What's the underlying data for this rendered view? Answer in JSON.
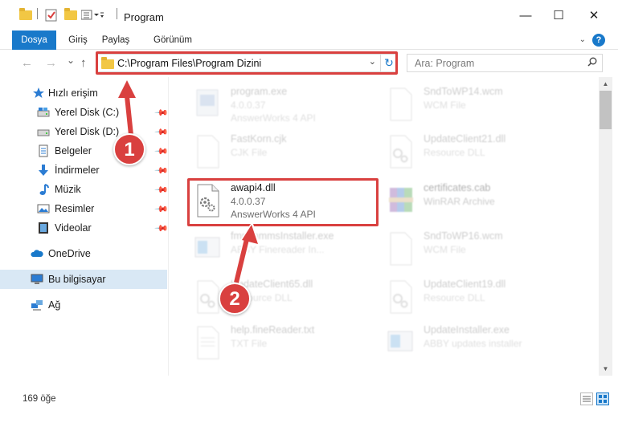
{
  "window": {
    "title": "Program",
    "minimize": "—",
    "maximize": "☐",
    "close": "✕"
  },
  "ribbon": {
    "tabs": [
      "Dosya",
      "Giriş",
      "Paylaş",
      "Görünüm"
    ],
    "help": "?"
  },
  "navigation": {
    "back": "←",
    "forward": "→",
    "recent": "⌄",
    "up": "↑",
    "address": "C:\\Program Files\\Program Dizini",
    "refresh": "↻",
    "search_placeholder": "Ara: Program"
  },
  "sidebar": {
    "quick_access": "Hızlı erişim",
    "items": [
      {
        "label": "Yerel Disk (C:)",
        "icon": "drive-icon",
        "pinned": true
      },
      {
        "label": "Yerel Disk (D:)",
        "icon": "drive-icon",
        "pinned": true
      },
      {
        "label": "Belgeler",
        "icon": "documents-icon",
        "pinned": true
      },
      {
        "label": "İndirmeler",
        "icon": "downloads-icon",
        "pinned": true
      },
      {
        "label": "Müzik",
        "icon": "music-icon",
        "pinned": true
      },
      {
        "label": "Resimler",
        "icon": "pictures-icon",
        "pinned": true
      },
      {
        "label": "Videolar",
        "icon": "videos-icon",
        "pinned": true
      }
    ],
    "onedrive": "OneDrive",
    "this_pc": "Bu bilgisayar",
    "network": "Ağ",
    "pin_glyph": "📌"
  },
  "files": [
    {
      "name": "program.exe",
      "l2": "4.0.0.37",
      "l3": "AnswerWorks 4 API",
      "icon": "exe-icon"
    },
    {
      "name": "SndToWP14.wcm",
      "l2": "WCM File",
      "l3": "",
      "icon": "blank-file-icon"
    },
    {
      "name": "FastKorn.cjk",
      "l2": "CJK File",
      "l3": "",
      "icon": "blank-file-icon"
    },
    {
      "name": "UpdateClient21.dll",
      "l2": "Resource DLL",
      "l3": "",
      "icon": "dll-icon"
    },
    {
      "name": "awapi4.dll",
      "l2": "4.0.0.37",
      "l3": "AnswerWorks 4 API",
      "icon": "dll-icon"
    },
    {
      "name": "certificates.cab",
      "l2": "WinRAR Archive",
      "l3": "",
      "icon": "archive-icon"
    },
    {
      "name": "fmmmmmsInstaller.exe",
      "l2": "ABBY Finereader In...",
      "l3": "",
      "icon": "installer-icon"
    },
    {
      "name": "SndToWP16.wcm",
      "l2": "WCM File",
      "l3": "",
      "icon": "blank-file-icon"
    },
    {
      "name": "UpdateClient65.dll",
      "l2": "Resource DLL",
      "l3": "",
      "icon": "dll-icon"
    },
    {
      "name": "UpdateClient19.dll",
      "l2": "Resource DLL",
      "l3": "",
      "icon": "dll-icon"
    },
    {
      "name": "help.fineReader.txt",
      "l2": "TXT File",
      "l3": "",
      "icon": "text-file-icon"
    },
    {
      "name": "UpdateInstaller.exe",
      "l2": "ABBY updates installer",
      "l3": "",
      "icon": "installer-icon"
    }
  ],
  "status": {
    "item_count": "169 öğe"
  },
  "callouts": [
    "1",
    "2"
  ],
  "colors": {
    "accent": "#1979ca",
    "highlight": "#d9403f",
    "selected_bg": "#d9e8f5"
  }
}
